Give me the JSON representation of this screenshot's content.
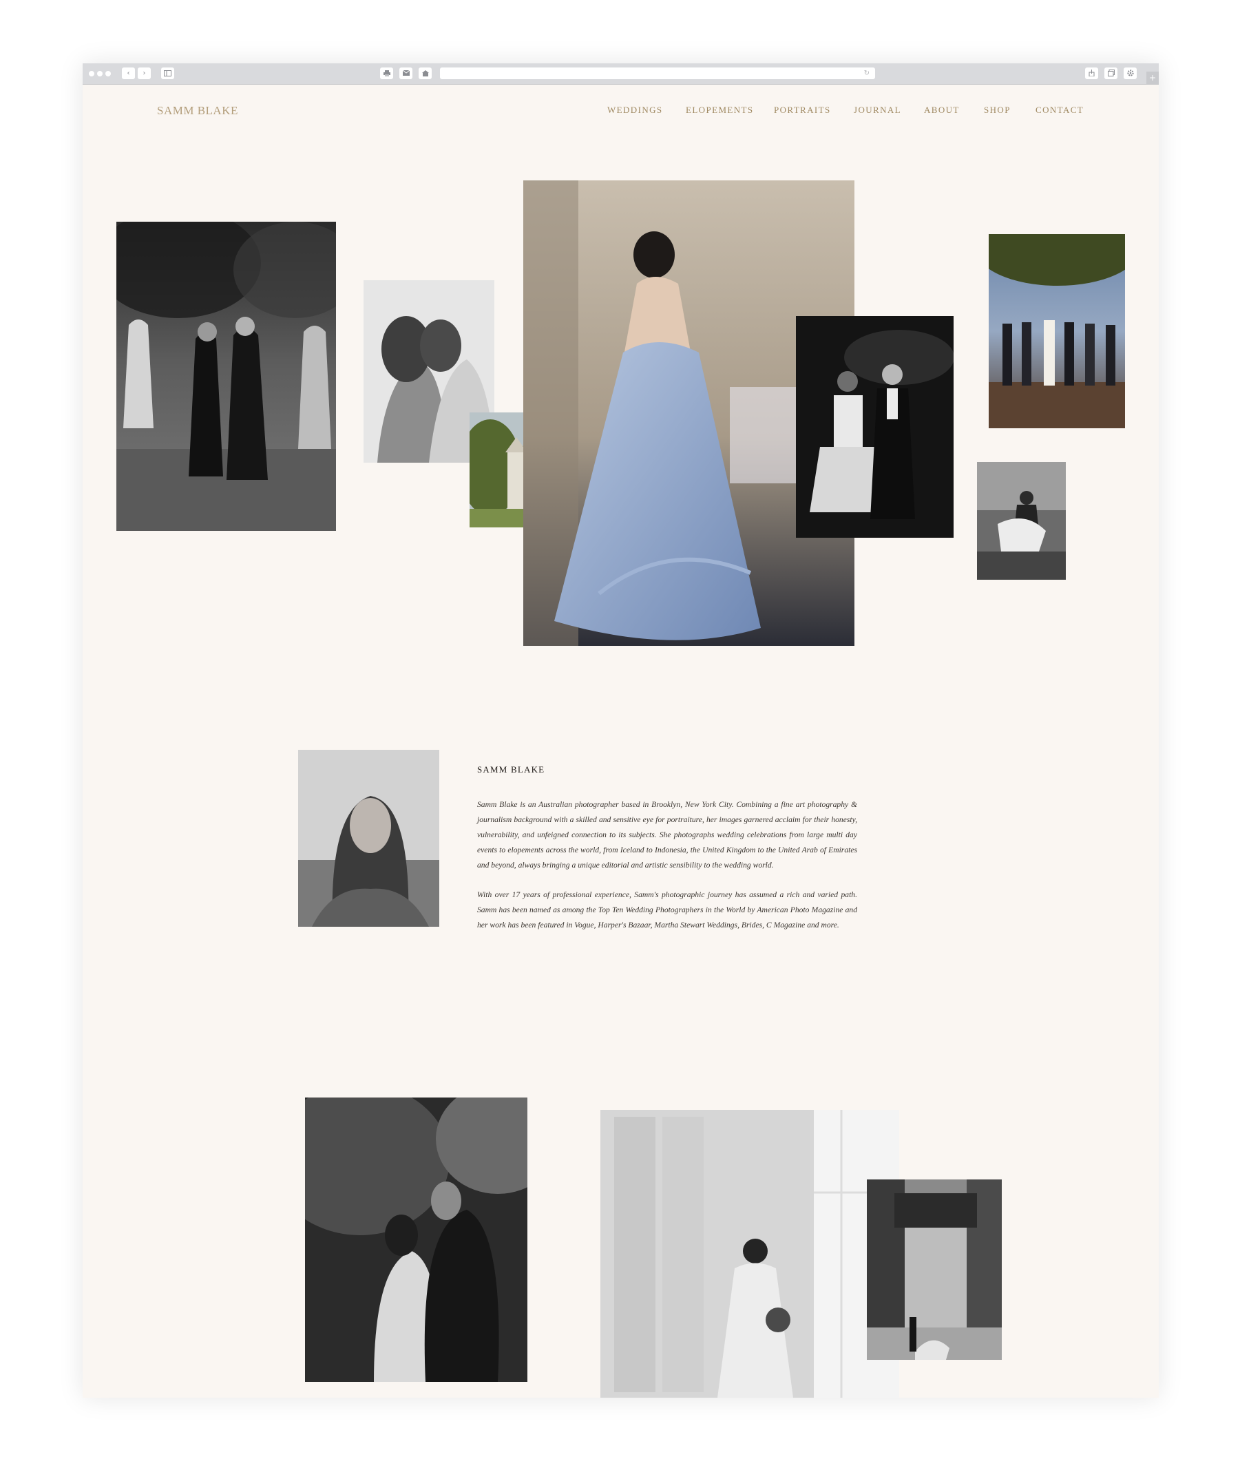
{
  "site": {
    "logo": "SAMM BLAKE"
  },
  "nav": {
    "items": [
      "WEDDINGS",
      "ELOPEMENTS",
      "PORTRAITS",
      "JOURNAL",
      "ABOUT",
      "SHOP",
      "CONTACT"
    ]
  },
  "browser": {
    "back_glyph": "‹",
    "forward_glyph": "›",
    "reload_glyph": "↻",
    "plus_glyph": "+"
  },
  "bio": {
    "name": "SAMM BLAKE",
    "paragraph_1": "Samm Blake is an Australian photographer based in Brooklyn, New York City. Combining a fine art photography & journalism background with a skilled and sensitive eye for portraiture, her images garnered acclaim for their honesty, vulnerability, and unfeigned connection to its subjects. She photographs wedding celebrations from large multi day events to elopements across the world, from Iceland to Indonesia, the United Kingdom to the United Arab of Emirates and beyond, always bringing a unique editorial and artistic sensibility to the wedding world.",
    "paragraph_2": "With over 17 years of professional experience, Samm's photographic journey has assumed a rich and varied path. Samm has been named as among the Top Ten Wedding Photographers in the World by American Photo Magazine and her work has been featured in Vogue, Harper's Bazaar, Martha Stewart Weddings, Brides, C Magazine and more."
  },
  "colors": {
    "page_background": "#faf6f2",
    "logo": "#b39e7b",
    "nav": "#a08a63",
    "text": "#1f1b18"
  }
}
